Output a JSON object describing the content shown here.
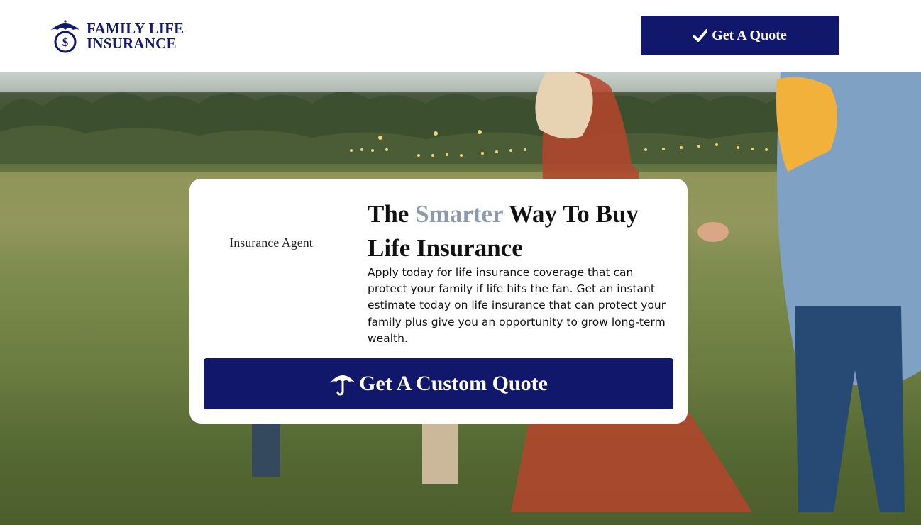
{
  "brand": {
    "line1": "FAMILY LIFE",
    "line2": "INSURANCE",
    "logo_icon": "umbrella-dollar-icon",
    "color": "#141a6b"
  },
  "header": {
    "quote_button": {
      "label": "Get A Quote",
      "icon": "check-icon"
    }
  },
  "hero": {
    "agent_image_alt": "Insurance Agent",
    "headline": {
      "before": "The ",
      "accent": "Smarter",
      "after": " Way To Buy Life Insurance"
    },
    "description": "Apply today for life insurance coverage that can protect your family if life hits the fan. Get an instant estimate today on life insurance that can protect your family plus give you an opportunity to grow long-term wealth.",
    "cta": {
      "label": "Get A Custom Quote",
      "icon": "umbrella-icon"
    }
  },
  "colors": {
    "primary": "#11176b",
    "accent_text": "#8d9aae",
    "card_bg": "#ffffff"
  }
}
